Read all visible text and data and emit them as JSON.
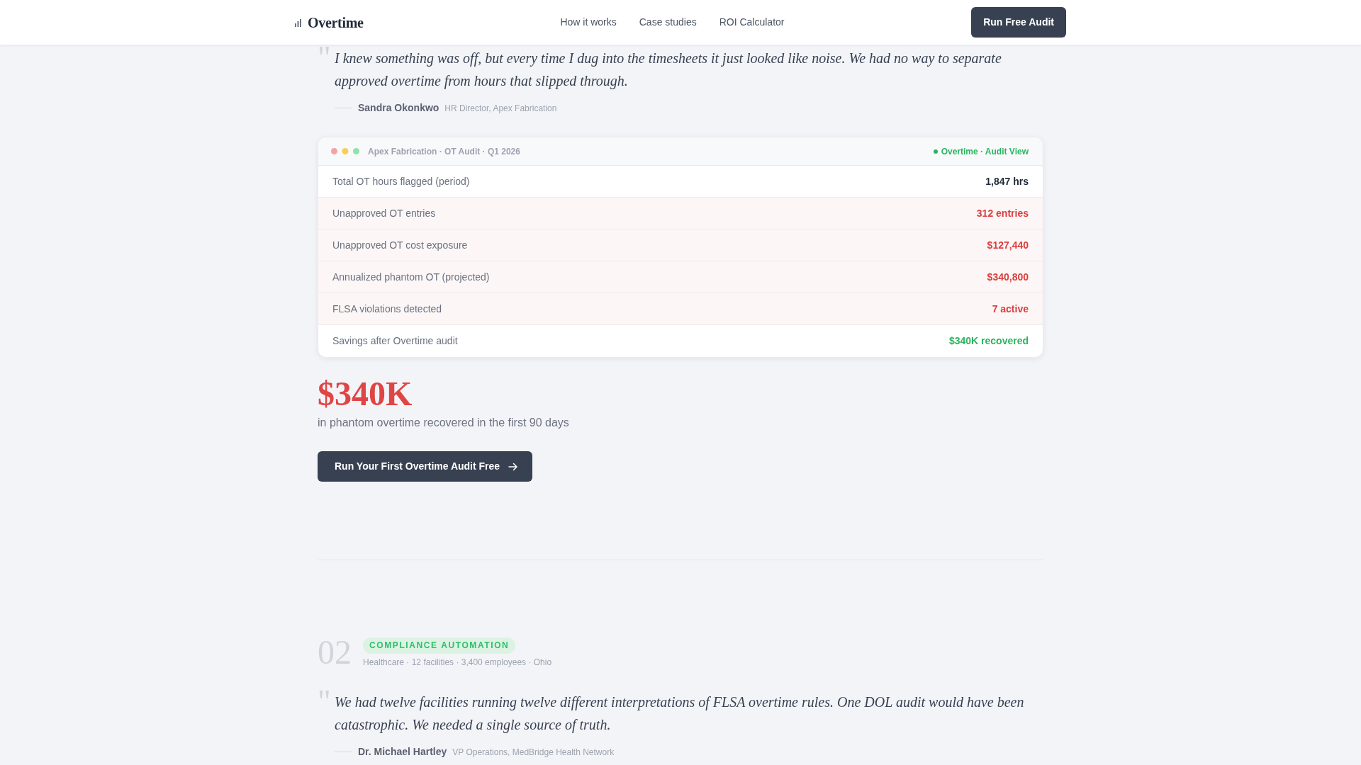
{
  "nav": {
    "brand": "Overtime",
    "links": [
      {
        "label": "How it works"
      },
      {
        "label": "Case studies"
      },
      {
        "label": "ROI Calculator"
      }
    ],
    "cta": "Run Free Audit"
  },
  "case_studies": [
    {
      "quote_mark": "\"",
      "quote": "I knew something was off, but every time I dug into the timesheets it just looked like noise. We had no way to separate approved overtime from hours that slipped through.",
      "author": "Sandra Okonkwo",
      "role": "HR Director, Apex Fabrication",
      "audit_card": {
        "title": "Apex Fabrication · OT Audit · Q1 2026",
        "status": "Overtime · Audit View",
        "rows": [
          {
            "label": "Total OT hours flagged (period)",
            "value": "1,847 hrs",
            "kind": "neutral"
          },
          {
            "label": "Unapproved OT entries",
            "value": "312 entries",
            "kind": "alert"
          },
          {
            "label": "Unapproved OT cost exposure",
            "value": "$127,440",
            "kind": "alert"
          },
          {
            "label": "Annualized phantom OT (projected)",
            "value": "$340,800",
            "kind": "alert"
          },
          {
            "label": "FLSA violations detected",
            "value": "7 active",
            "kind": "alert"
          },
          {
            "label": "Savings after Overtime audit",
            "value": "$340K recovered",
            "kind": "success"
          }
        ]
      },
      "stat": "$340K",
      "stat_caption": "in phantom overtime recovered in the first 90 days",
      "cta": "Run Your First Overtime Audit Free"
    },
    {
      "number": "02",
      "tag": "COMPLIANCE AUTOMATION",
      "meta": "Healthcare · 12 facilities · 3,400 employees · Ohio",
      "quote_mark": "\"",
      "quote": "We had twelve facilities running twelve different interpretations of FLSA overtime rules. One DOL audit would have been catastrophic. We needed a single source of truth.",
      "author": "Dr. Michael Hartley",
      "role": "VP Operations, MedBridge Health Network"
    }
  ]
}
